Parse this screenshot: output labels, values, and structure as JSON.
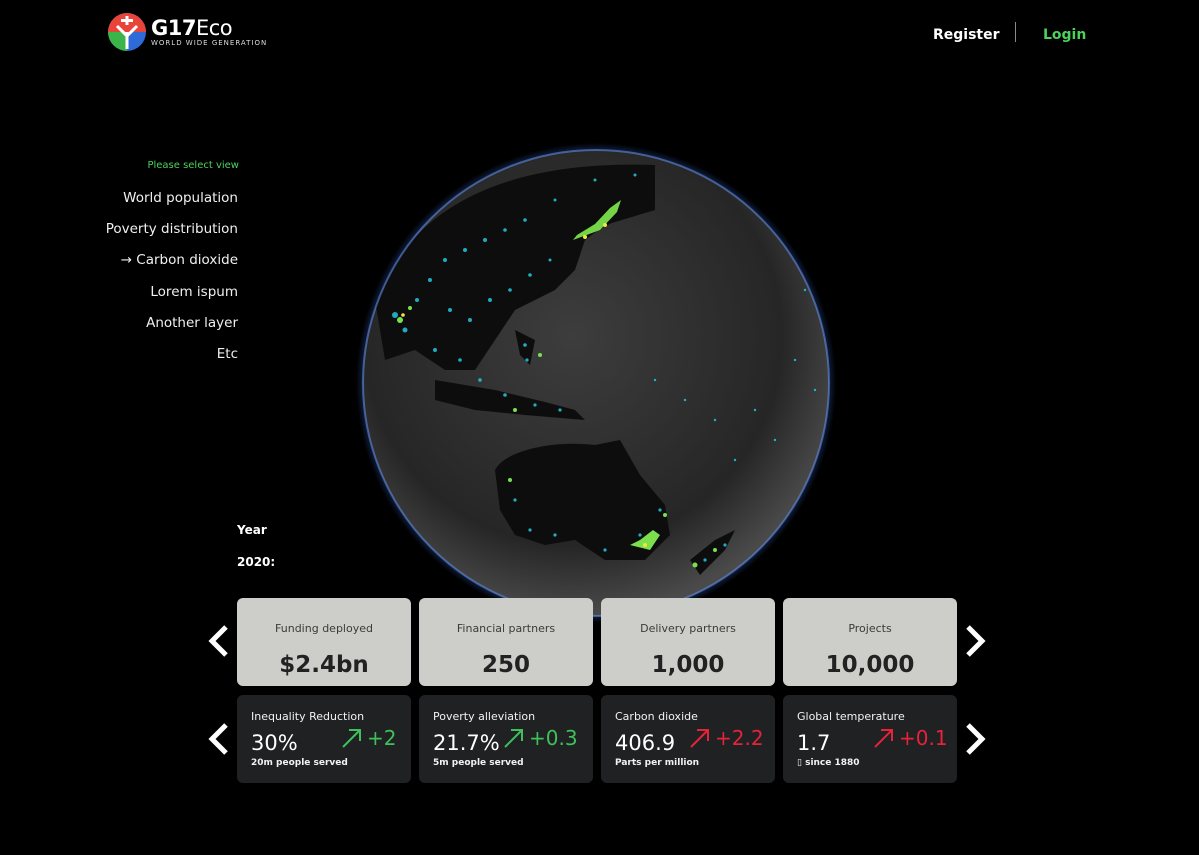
{
  "header": {
    "logo_title_a": "G17",
    "logo_title_b": "Eco",
    "logo_subtitle": "WORLD WIDE GENERATION",
    "register": "Register",
    "login": "Login"
  },
  "layers": {
    "prompt": "Please select view",
    "items": [
      "World population",
      "Poverty distribution",
      "→ Carbon dioxide",
      "Lorem ispum",
      "Another layer",
      "Etc"
    ]
  },
  "year": {
    "label": "Year",
    "value": "2020:"
  },
  "stats": [
    {
      "label": "Funding deployed",
      "value": "$2.4bn"
    },
    {
      "label": "Financial partners",
      "value": "250"
    },
    {
      "label": "Delivery partners",
      "value": "1,000"
    },
    {
      "label": "Projects",
      "value": "10,000"
    }
  ],
  "metrics": [
    {
      "title": "Inequality Reduction",
      "value": "30%",
      "delta": "+2",
      "note": "20m people served",
      "trend": "up",
      "color": "#3fc15a"
    },
    {
      "title": "Poverty alleviation",
      "value": "21.7%",
      "delta": "+0.3",
      "note": "5m people served",
      "trend": "up",
      "color": "#3fc15a"
    },
    {
      "title": "Carbon dioxide",
      "value": "406.9",
      "delta": "+2.2",
      "note": "Parts per million",
      "trend": "up",
      "color": "#e5233b"
    },
    {
      "title": "Global temperature",
      "value": "1.7",
      "delta": "+0.1",
      "note": "▯ since 1880",
      "trend": "up",
      "color": "#e5233b"
    }
  ],
  "icons": {
    "prev": "chevron-left-icon",
    "next": "chevron-right-icon",
    "trend": "trend-up-arrow-icon"
  },
  "colors": {
    "accent_green": "#4cd15c",
    "positive": "#3fc15a",
    "negative": "#e5233b",
    "card_light": "#cdcdc9",
    "card_dark": "#1f2123"
  }
}
